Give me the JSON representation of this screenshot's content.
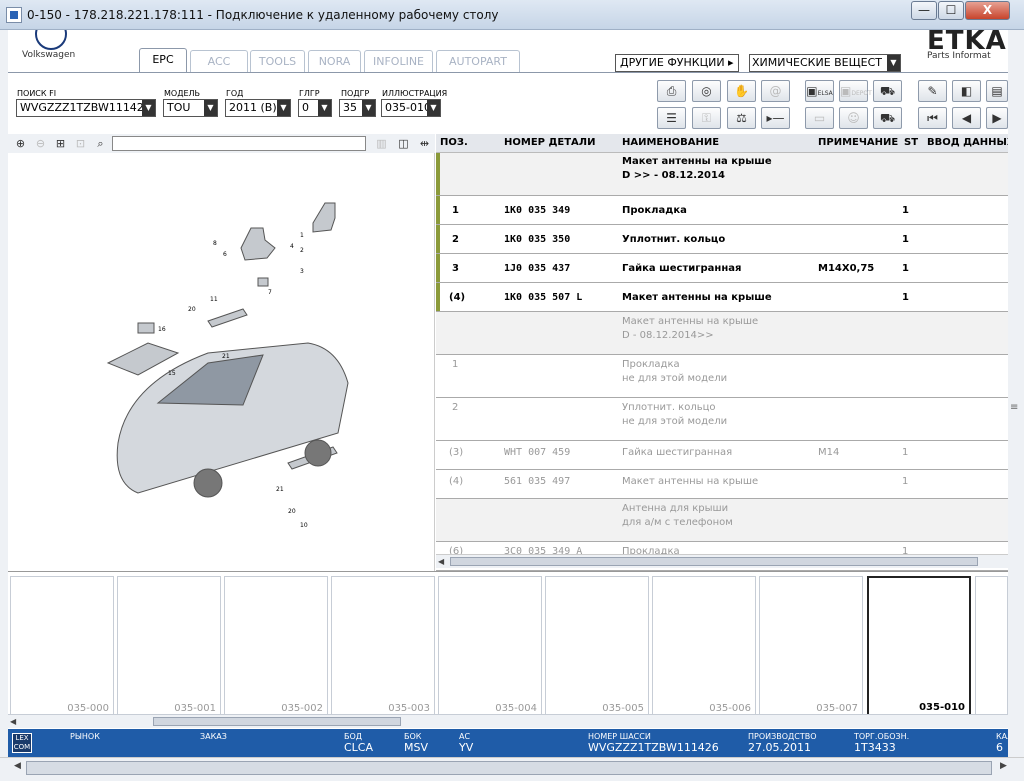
{
  "window": {
    "title": "0-150 - 178.218.221.178:111 - Подключение к удаленному рабочему столу",
    "min": "—",
    "max": "☐",
    "close": "X"
  },
  "brand": {
    "vw": "Volkswagen",
    "etka": "ETKA",
    "etka_sub": "Parts Informat"
  },
  "tabs": [
    {
      "label": "EPC",
      "active": true
    },
    {
      "label": "ACC"
    },
    {
      "label": "TOOLS"
    },
    {
      "label": "NORA"
    },
    {
      "label": "INFOLINE"
    },
    {
      "label": "AUTOPART"
    }
  ],
  "functions": {
    "label": "ДРУГИЕ ФУНКЦИИ ▸",
    "value": "ХИМИЧЕСКИЕ ВЕЩЕСТ"
  },
  "filters": [
    {
      "label": "ПОИСК FI",
      "value": "WVGZZZ1TZBW11142"
    },
    {
      "label": "МОДЕЛЬ",
      "value": "TOU"
    },
    {
      "label": "ГОД",
      "value": "2011 (B)"
    },
    {
      "label": "ГЛГР",
      "value": "0"
    },
    {
      "label": "ПОДГР",
      "value": "35"
    },
    {
      "label": "ИЛЛЮСТРАЦИЯ",
      "value": "035-010"
    }
  ],
  "toolbar": {
    "elsa": "ELSA",
    "depot": "DEPOT"
  },
  "table": {
    "headers": {
      "pos": "ПОЗ.",
      "part": "НОМЕР ДЕТАЛИ",
      "name": "НАИМЕНОВАНИЕ",
      "note": "ПРИМЕЧАНИЕ",
      "st": "ST",
      "input": "ВВОД ДАННЫХ"
    },
    "rows": [
      {
        "pos": "",
        "part": "",
        "name": "Макет антенны на крыше",
        "name2": "D            >> - 08.12.2014",
        "note": "",
        "st": ""
      },
      {
        "pos": "1",
        "part": "1K0 035 349",
        "name": "Прокладка",
        "name2": "",
        "note": "",
        "st": "1"
      },
      {
        "pos": "2",
        "part": "1K0 035 350",
        "name": "Уплотнит. кольцо",
        "name2": "",
        "note": "",
        "st": "1"
      },
      {
        "pos": "3",
        "part": "1J0 035 437",
        "name": "Гайка шестигранная",
        "name2": "",
        "note": "M14X0,75",
        "st": "1"
      },
      {
        "pos": "(4)",
        "part": "1K0 035 507 L",
        "name": "Макет антенны на крыше",
        "name2": "",
        "note": "",
        "st": "1"
      },
      {
        "pos": "",
        "part": "",
        "name": "Макет антенны на крыше",
        "name2": "D - 08.12.2014>>",
        "note": "",
        "st": ""
      },
      {
        "pos": "1",
        "part": "",
        "name": "Прокладка",
        "name2": "не для этой модели",
        "note": "",
        "st": ""
      },
      {
        "pos": "2",
        "part": "",
        "name": "Уплотнит. кольцо",
        "name2": "не для этой модели",
        "note": "",
        "st": ""
      },
      {
        "pos": "(3)",
        "part": "WHT 007 459",
        "name": "Гайка шестигранная",
        "name2": "",
        "note": "M14",
        "st": "1"
      },
      {
        "pos": "(4)",
        "part": "561 035 497",
        "name": "Макет антенны на крыше",
        "name2": "",
        "note": "",
        "st": "1"
      },
      {
        "pos": "",
        "part": "",
        "name": "Антенна для крыши",
        "name2": "для а/м с телефоном",
        "note": "",
        "st": ""
      },
      {
        "pos": "(6)",
        "part": "3C0 035 349 A",
        "name": "Прокладка",
        "name2": "",
        "note": "",
        "st": "1"
      }
    ]
  },
  "diagram_labels": [
    "8",
    "6",
    "4",
    "1",
    "2",
    "3",
    "7",
    "11",
    "20",
    "16",
    "21",
    "15",
    "21",
    "20",
    "10"
  ],
  "thumbnails": [
    "035-000",
    "035-001",
    "035-002",
    "035-003",
    "035-004",
    "035-005",
    "035-006",
    "035-007",
    "035-010"
  ],
  "status": [
    {
      "label": "РЫНОК",
      "value": ""
    },
    {
      "label": "ЗАКАЗ",
      "value": ""
    },
    {
      "label": "БОД",
      "value": "CLCA"
    },
    {
      "label": "БОК",
      "value": "MSV"
    },
    {
      "label": "АС",
      "value": "YV"
    },
    {
      "label": "НОМЕР ШАССИ",
      "value": "WVGZZZ1TZBW111426"
    },
    {
      "label": "ПРОИЗВОДСТВО",
      "value": "27.05.2011"
    },
    {
      "label": "ТОРГ.ОБОЗН.",
      "value": "1T3433"
    },
    {
      "label": "КАЛ",
      "value": "6"
    }
  ],
  "status_logo": "LEX COM"
}
